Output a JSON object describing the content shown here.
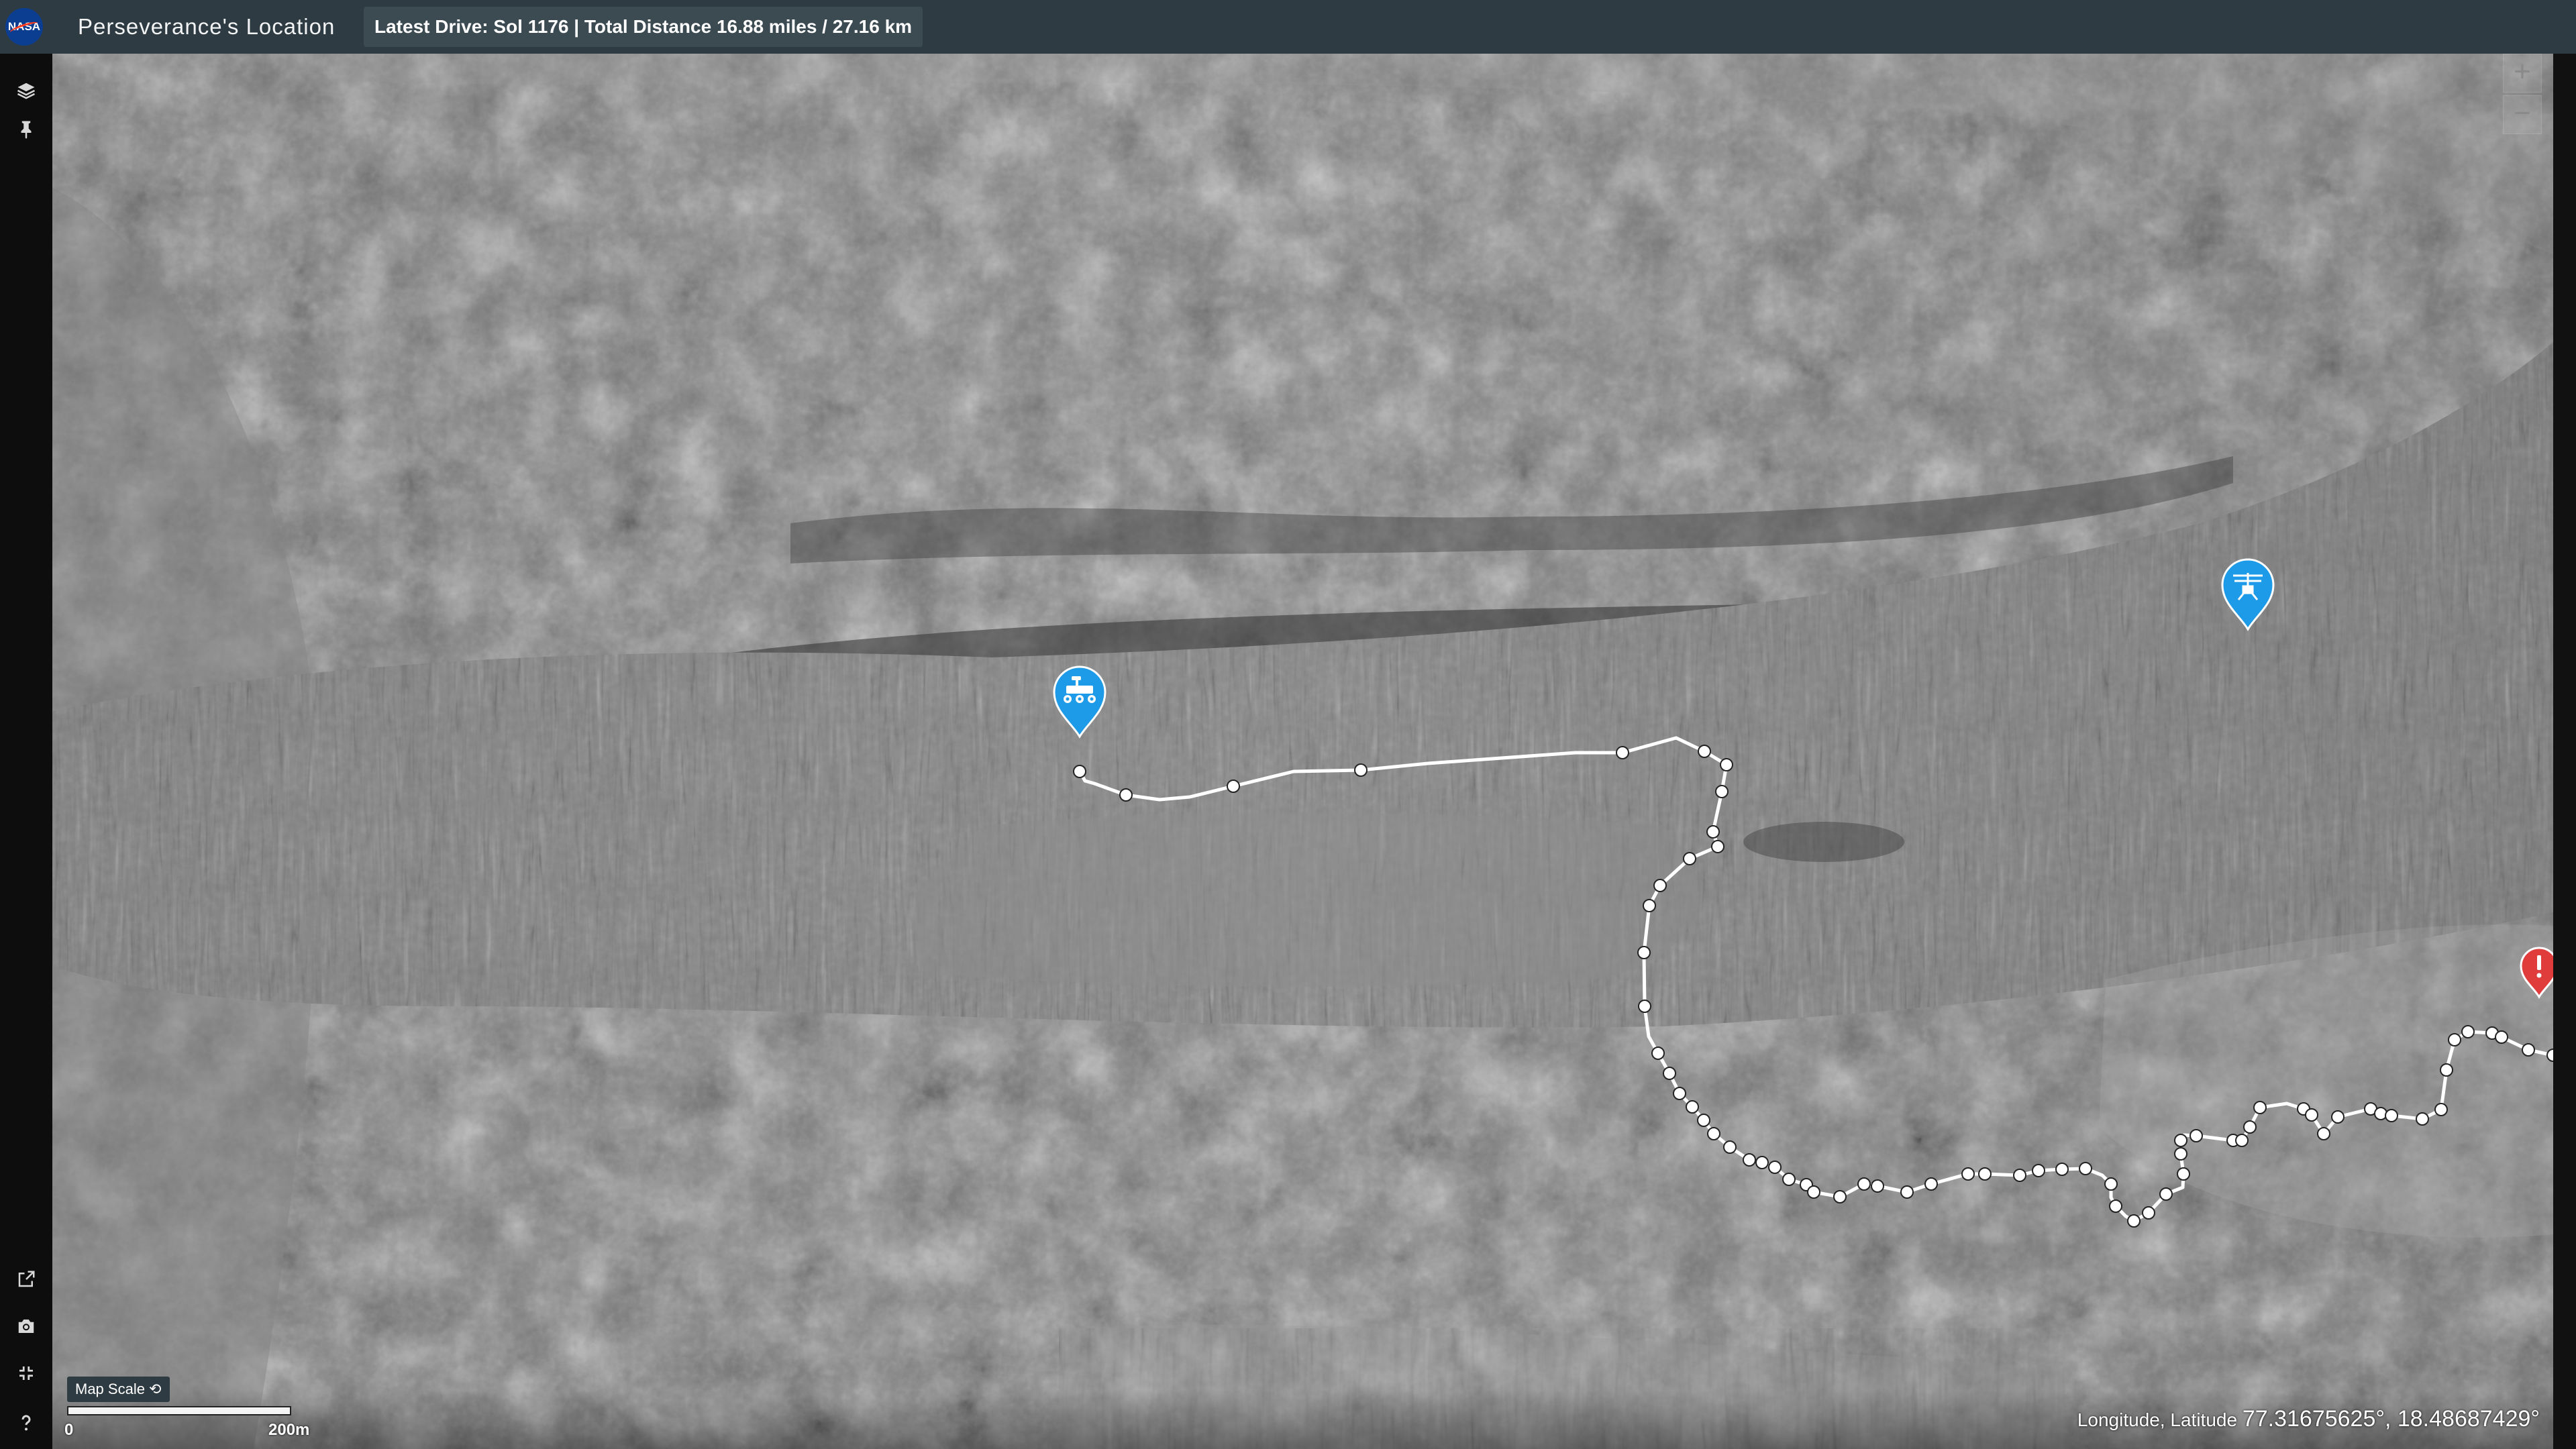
{
  "header": {
    "logo_text": "NASA",
    "title": "Perseverance's Location",
    "drive_info": "Latest Drive: Sol 1176 | Total Distance 16.88 miles / 27.16 km"
  },
  "sidebar": {
    "items": [
      {
        "name": "layers",
        "icon": "layers-icon"
      },
      {
        "name": "pin",
        "icon": "pin-icon"
      },
      {
        "name": "external-link",
        "icon": "external-link-icon"
      },
      {
        "name": "screenshot",
        "icon": "camera-icon"
      },
      {
        "name": "fullscreen",
        "icon": "fullscreen-icon"
      },
      {
        "name": "help",
        "icon": "help-icon"
      }
    ]
  },
  "map": {
    "zoom_in": "+",
    "zoom_out": "−",
    "markers": [
      {
        "name": "perseverance-rover",
        "icon": "rover-icon",
        "color": "#1e9be8"
      },
      {
        "name": "ingenuity-helicopter",
        "icon": "helicopter-icon",
        "color": "#1e9be8"
      },
      {
        "name": "alert",
        "icon": "alert-icon",
        "color": "#e03c3c"
      }
    ],
    "traverse_color": "#ffffff"
  },
  "scale": {
    "button_label": "Map Scale ⟲",
    "start_label": "0",
    "end_label": "200m"
  },
  "coordinates": {
    "label": "Longitude, Latitude",
    "value": "77.31675625°, 18.48687429°"
  }
}
